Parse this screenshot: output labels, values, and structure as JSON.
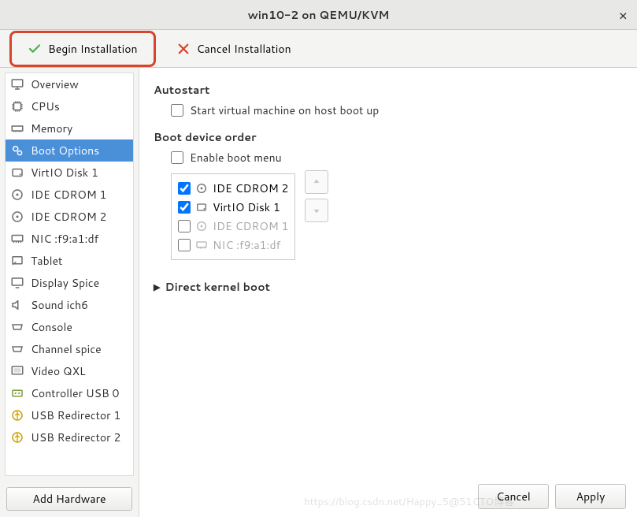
{
  "title": "win10-2 on QEMU/KVM",
  "toolbar": {
    "begin": "Begin Installation",
    "cancel": "Cancel Installation"
  },
  "sidebar": {
    "items": [
      {
        "label": "Overview",
        "icon": "monitor-icon"
      },
      {
        "label": "CPUs",
        "icon": "cpu-icon"
      },
      {
        "label": "Memory",
        "icon": "memory-icon"
      },
      {
        "label": "Boot Options",
        "icon": "gears-icon",
        "selected": true
      },
      {
        "label": "VirtIO Disk 1",
        "icon": "disk-icon"
      },
      {
        "label": "IDE CDROM 1",
        "icon": "optical-icon"
      },
      {
        "label": "IDE CDROM 2",
        "icon": "optical-icon"
      },
      {
        "label": "NIC :f9:a1:df",
        "icon": "nic-icon"
      },
      {
        "label": "Tablet",
        "icon": "tablet-icon"
      },
      {
        "label": "Display Spice",
        "icon": "display-icon"
      },
      {
        "label": "Sound ich6",
        "icon": "sound-icon"
      },
      {
        "label": "Console",
        "icon": "serial-icon"
      },
      {
        "label": "Channel spice",
        "icon": "serial-icon"
      },
      {
        "label": "Video QXL",
        "icon": "video-icon"
      },
      {
        "label": "Controller USB 0",
        "icon": "usb-controller-icon"
      },
      {
        "label": "USB Redirector 1",
        "icon": "usb-icon"
      },
      {
        "label": "USB Redirector 2",
        "icon": "usb-icon"
      }
    ],
    "add_hw": "Add Hardware"
  },
  "main": {
    "autostart_title": "Autostart",
    "autostart_cb": "Start virtual machine on host boot up",
    "bootorder_title": "Boot device order",
    "enable_menu_cb": "Enable boot menu",
    "boot_items": [
      {
        "label": "IDE CDROM 2",
        "checked": true,
        "enabled": true,
        "icon": "optical-icon"
      },
      {
        "label": "VirtIO Disk 1",
        "checked": true,
        "enabled": true,
        "icon": "disk-icon"
      },
      {
        "label": "IDE CDROM 1",
        "checked": false,
        "enabled": false,
        "icon": "optical-icon"
      },
      {
        "label": "NIC :f9:a1:df",
        "checked": false,
        "enabled": false,
        "icon": "nic-icon"
      }
    ],
    "direct_kernel": "Direct kernel boot"
  },
  "footer": {
    "cancel": "Cancel",
    "apply": "Apply"
  },
  "watermark": "https://blog.csdn.net/Happy_5@51CTO博客"
}
